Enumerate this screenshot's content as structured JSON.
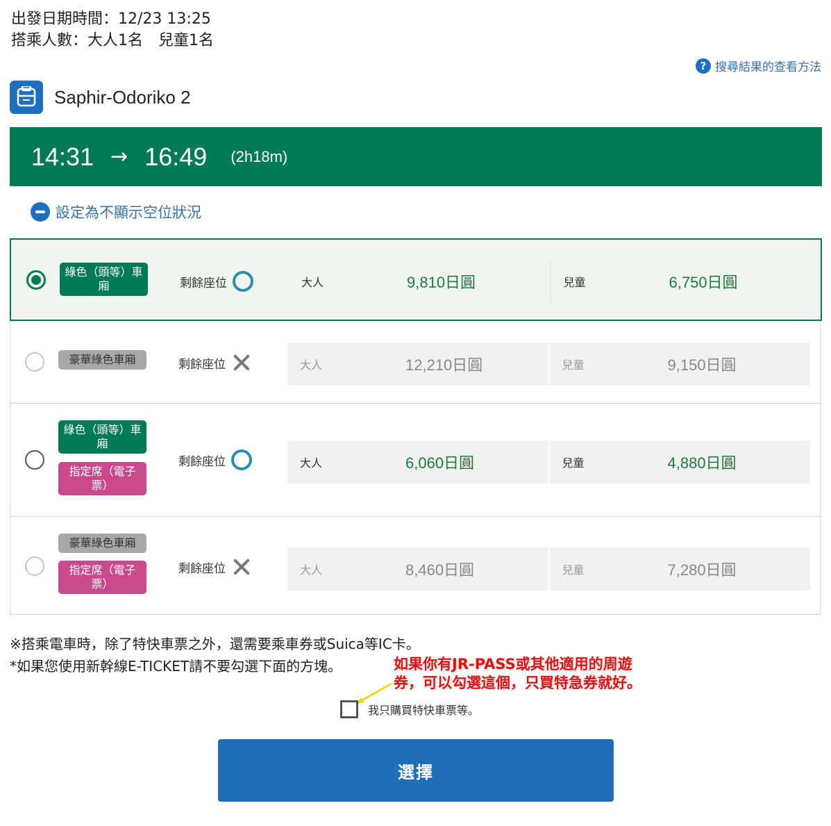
{
  "header": {
    "departure_label": "出發日期時間：",
    "departure_value": "12/23 13:25",
    "passengers_label": "搭乘人數：",
    "passengers_value": "大人1名　兒童1名",
    "help_link": "搜尋結果的查看方法"
  },
  "train": {
    "name": "Saphir-Odoriko 2",
    "icon": "train-icon",
    "departure_time": "14:31",
    "arrow": "→",
    "arrival_time": "16:49",
    "duration": "(2h18m)"
  },
  "toggle_label": "設定為不顯示空位狀況",
  "availability_label": "剩餘座位",
  "adult_label": "大人",
  "child_label": "兒童",
  "seat_options": [
    {
      "badges": [
        "綠色（頭等）車廂"
      ],
      "availability": "circle",
      "adult_price": "9,810日圓",
      "child_price": "6,750日圓",
      "selected": true,
      "available": true
    },
    {
      "badges": [
        "豪華綠色車廂"
      ],
      "availability": "cross",
      "adult_price": "12,210日圓",
      "child_price": "9,150日圓",
      "selected": false,
      "available": false
    },
    {
      "badges": [
        "綠色（頭等）車廂",
        "指定席（電子票）"
      ],
      "availability": "circle",
      "adult_price": "6,060日圓",
      "child_price": "4,880日圓",
      "selected": false,
      "available": true
    },
    {
      "badges": [
        "豪華綠色車廂",
        "指定席（電子票）"
      ],
      "availability": "cross",
      "adult_price": "8,460日圓",
      "child_price": "7,280日圓",
      "selected": false,
      "available": false
    }
  ],
  "notes": {
    "line1": "※搭乘電車時，除了特快車票之外，還需要乘車券或Suica等IC卡。",
    "line2": "*如果您使用新幹線E-TICKET請不要勾選下面的方塊。"
  },
  "annotation": {
    "line1": "如果你有JR-PASS或其他適用的周遊",
    "line2": "券，可以勾選這個，只買特急券就好。"
  },
  "checkbox_label": "我只購買特快車票等。",
  "select_button": "選擇",
  "colors": {
    "brand_green": "#007a55",
    "button_blue": "#1e6fb5",
    "pink_badge": "#c94a8c",
    "annotation_red": "#e01010"
  }
}
